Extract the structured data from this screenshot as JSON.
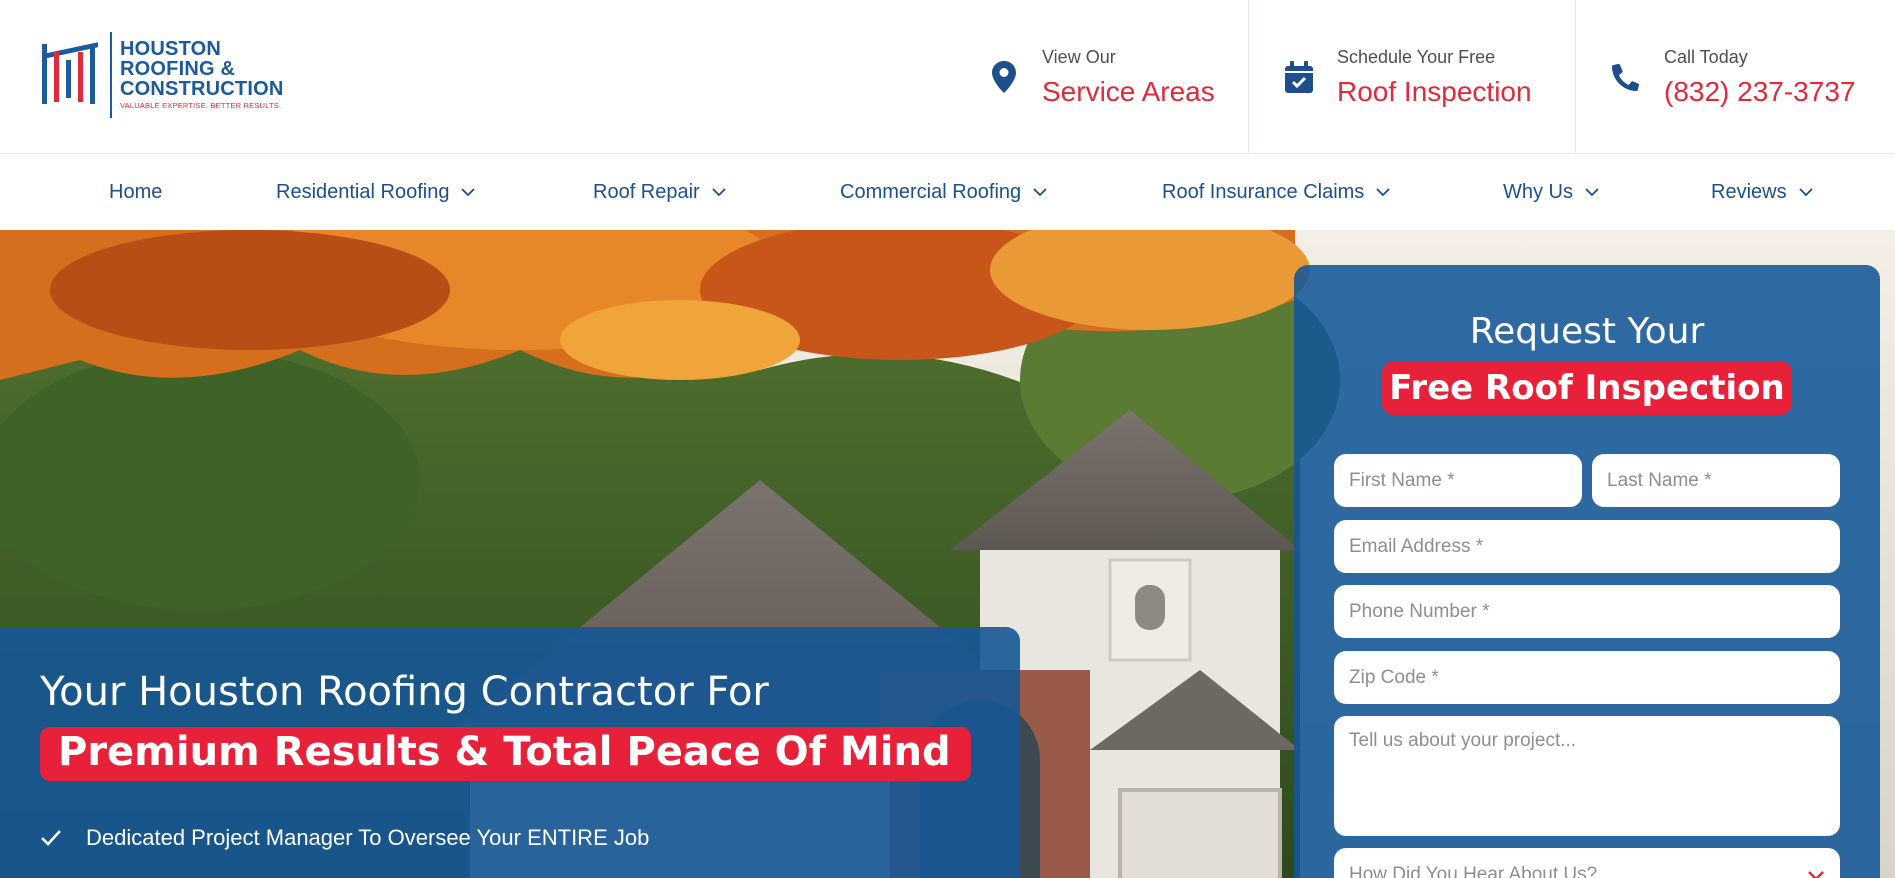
{
  "logo": {
    "line1": "HOUSTON",
    "line2": "ROOFING &",
    "line3": "CONSTRUCTION",
    "tagline": "VALUABLE EXPERTISE. BETTER RESULTS."
  },
  "header": {
    "areas": {
      "small": "View Our",
      "big": "Service Areas",
      "icon": "map-pin-icon"
    },
    "inspection": {
      "small": "Schedule Your Free",
      "big": "Roof Inspection",
      "icon": "calendar-check-icon"
    },
    "call": {
      "small": "Call Today",
      "big": "(832) 237-3737",
      "icon": "phone-icon"
    }
  },
  "nav": {
    "items": [
      {
        "label": "Home"
      },
      {
        "label": "Residential Roofing"
      },
      {
        "label": "Roof Repair"
      },
      {
        "label": "Commercial Roofing"
      },
      {
        "label": "Roof Insurance Claims"
      },
      {
        "label": "Why Us"
      },
      {
        "label": "Reviews"
      }
    ]
  },
  "hero": {
    "title_line1": "Your Houston Roofing Contractor For",
    "title_line2": "Premium Results & Total Peace Of Mind",
    "bullet1": "Dedicated Project Manager To Oversee Your ENTIRE Job"
  },
  "form": {
    "title_line1": "Request Your",
    "title_line2": "Free Roof Inspection",
    "first_name_placeholder": "First Name *",
    "last_name_placeholder": "Last Name *",
    "email_placeholder": "Email Address *",
    "phone_placeholder": "Phone Number *",
    "zip_placeholder": "Zip Code *",
    "message_placeholder": "Tell us about your project...",
    "hear_placeholder": "How Did You Hear About Us?"
  },
  "colors": {
    "brand_blue": "#1c4f8c",
    "accent_red": "#e02a3c",
    "panel_blue": "#165696"
  }
}
